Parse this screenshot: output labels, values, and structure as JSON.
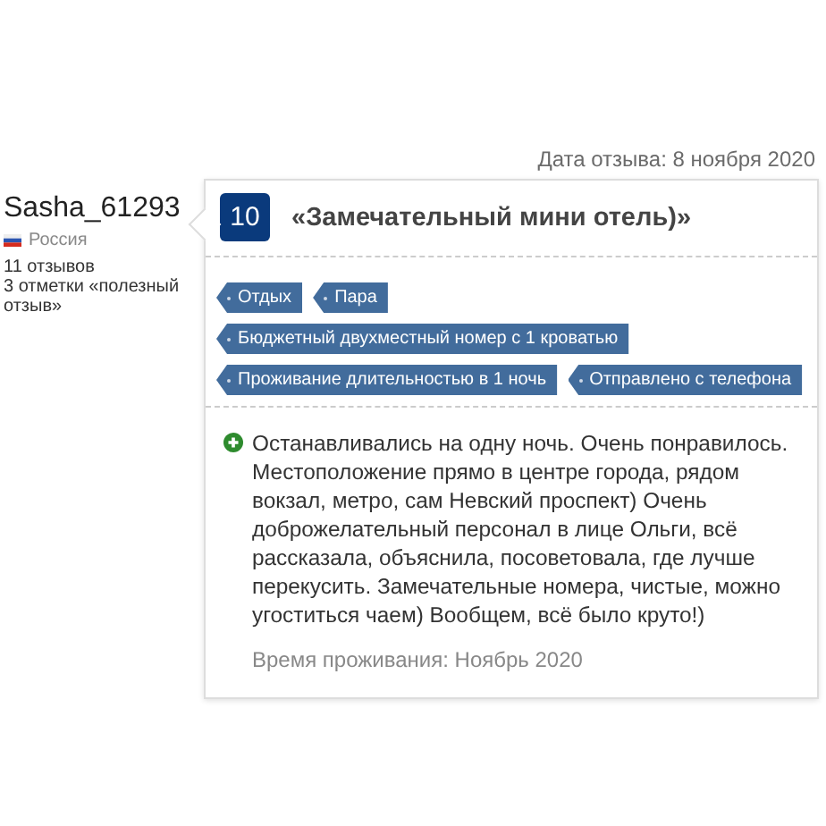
{
  "review_date": "Дата отзыва: 8 ноября 2020",
  "user": {
    "name": "Sasha_61293",
    "country": "Россия",
    "reviews_count": "11 отзывов",
    "helpful_votes": "3 отметки «полезный отзыв»"
  },
  "review": {
    "score": "10",
    "title": "«Замечательный мини отель)»",
    "tag_rows": [
      [
        "Отдых",
        "Пара"
      ],
      [
        "Бюджетный двухместный номер с 1 кроватью"
      ],
      [
        "Проживание длительностью в 1 ночь",
        "Отправлено с телефона"
      ]
    ],
    "positive_text": "Останавливались на одну ночь. Очень понравилось. Местоположение прямо в центре города, рядом вокзал, метро, сам Невский проспект) Очень доброжелательный персонал в лице Ольги, всё рассказала, объяснила, посоветовала, где лучше перекусить. Замечательные номера, чистые, можно угоститься чаем) Вообщем, всё было круто!)",
    "stay_period": "Время проживания: Ноябрь 2020"
  }
}
